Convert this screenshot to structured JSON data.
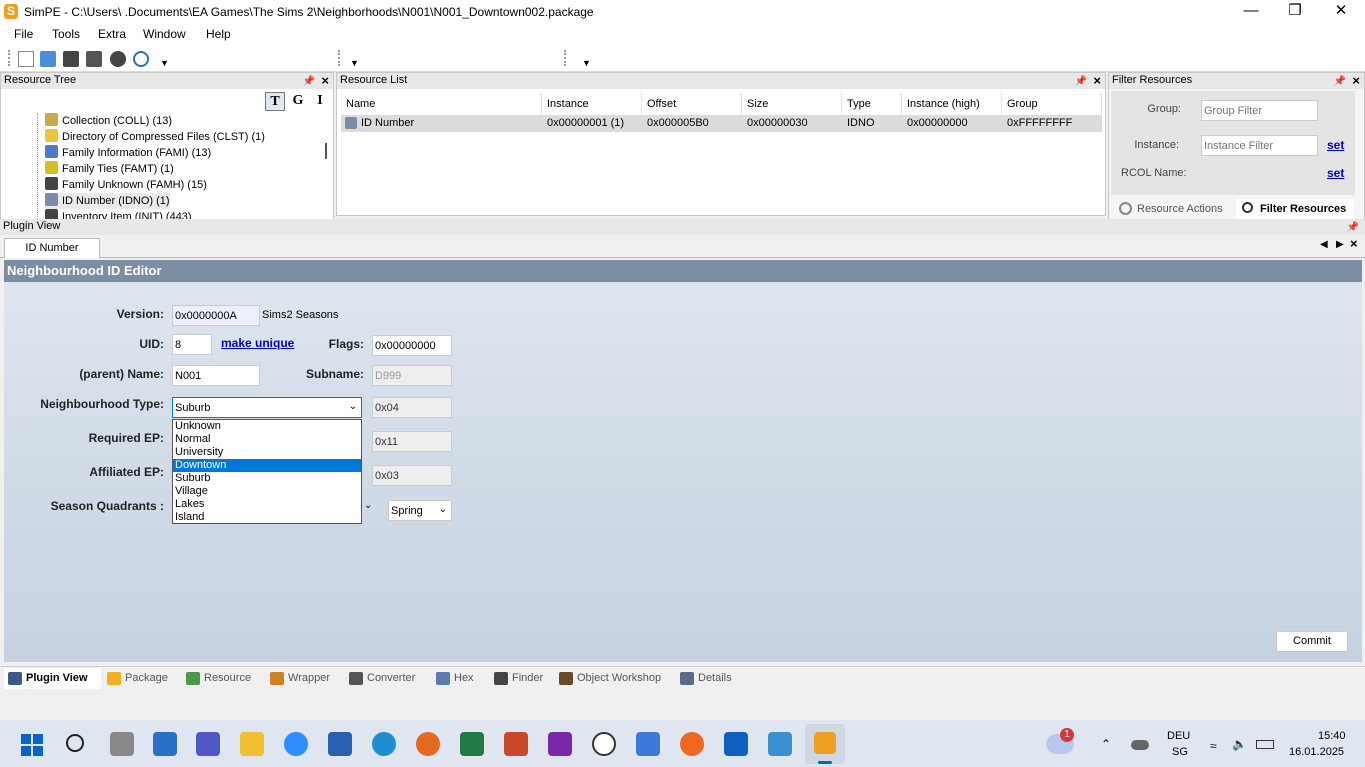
{
  "window": {
    "title": "SimPE - C:\\Users\\         .Documents\\EA Games\\The Sims 2\\Neighborhoods\\N001\\N001_Downtown002.package"
  },
  "menu": [
    "File",
    "Tools",
    "Extra",
    "Window",
    "Help"
  ],
  "resource_tree": {
    "title": "Resource Tree",
    "buttons": [
      "T",
      "G",
      "I"
    ],
    "items": [
      {
        "label": "Collection (COLL) (13)",
        "icon": "collection-icon",
        "color": "#c9a94a"
      },
      {
        "label": "Directory of Compressed Files (CLST) (1)",
        "icon": "directory-icon",
        "color": "#f0c040"
      },
      {
        "label": "Family Information (FAMI) (13)",
        "icon": "family-icon",
        "color": "#4a7cc9"
      },
      {
        "label": "Family Ties (FAMT) (1)",
        "icon": "family-ties-icon",
        "color": "#d8c020"
      },
      {
        "label": "Family Unknown (FAMH) (15)",
        "icon": "cube-icon",
        "color": "#444444"
      },
      {
        "label": "ID Number (IDNO) (1)",
        "icon": "id-icon",
        "color": "#7a8da8"
      },
      {
        "label": "Inventory Item (INIT) (443)",
        "icon": "cube-icon",
        "color": "#444444"
      }
    ]
  },
  "resource_list": {
    "title": "Resource List",
    "columns": [
      "Name",
      "Instance",
      "Offset",
      "Size",
      "Type",
      "Instance (high)",
      "Group"
    ],
    "rows": [
      [
        "ID Number",
        "0x00000001 (1)",
        "0x000005B0",
        "0x00000030",
        "IDNO",
        "0x00000000",
        "0xFFFFFFFF"
      ]
    ]
  },
  "filter": {
    "title": "Filter Resources",
    "group_label": "Group:",
    "group_placeholder": "Group Filter",
    "instance_label": "Instance:",
    "instance_placeholder": "Instance Filter",
    "set_label": "set",
    "rcol_label": "RCOL Name:",
    "tabs": [
      "Resource Actions",
      "Filter Resources"
    ]
  },
  "plugin_view": {
    "title": "Plugin View",
    "tab": "ID Number",
    "editor_title": "Neighbourhood ID Editor",
    "version_label": "Version:",
    "version_value": "0x0000000A",
    "version_name": "Sims2 Seasons",
    "uid_label": "UID:",
    "uid_value": "8",
    "make_unique": "make unique",
    "flags_label": "Flags:",
    "flags_value": "0x00000000",
    "name_label": "(parent) Name:",
    "name_value": "N001",
    "subname_label": "Subname:",
    "subname_value": "D999",
    "type_label": "Neighbourhood Type:",
    "type_value": "Suburb",
    "type_code": "0x04",
    "req_label": "Required EP:",
    "req_code": "0x11",
    "aff_label": "Affiliated EP:",
    "aff_code": "0x03",
    "season_label": "Season Quadrants :",
    "season_value": "Spring",
    "dropdown_options": [
      "Unknown",
      "Normal",
      "University",
      "Downtown",
      "Suburb",
      "Village",
      "Lakes",
      "Island"
    ],
    "dropdown_highlight": "Downtown",
    "commit": "Commit"
  },
  "bottom_tabs": [
    "Plugin View",
    "Package",
    "Resource",
    "Wrapper",
    "Converter",
    "Hex",
    "Finder",
    "Object Workshop",
    "Details"
  ],
  "taskbar": {
    "lang": "DEU",
    "region": "SG",
    "time": "15:40",
    "date": "16.01.2025",
    "badge": "1"
  }
}
